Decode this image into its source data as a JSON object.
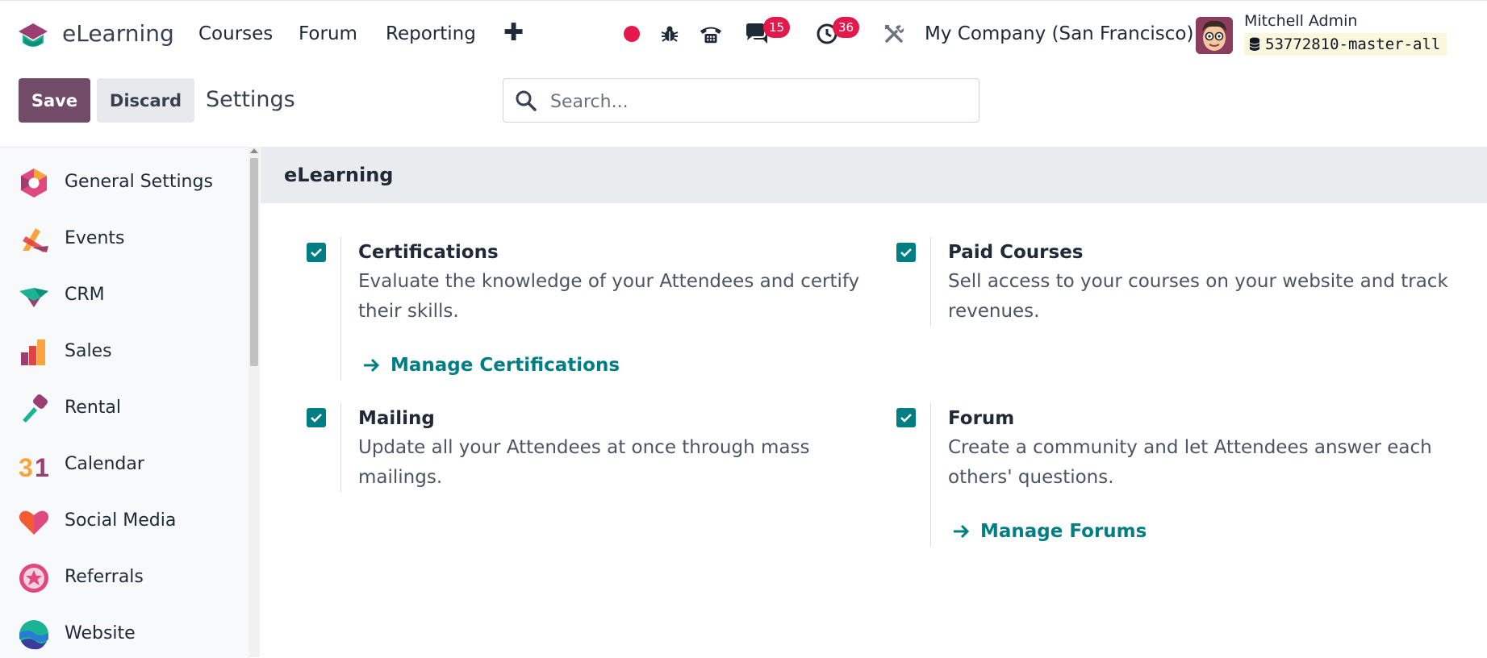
{
  "navbar": {
    "app_name": "eLearning",
    "menus": [
      "Courses",
      "Forum",
      "Reporting"
    ],
    "add_icon": "plus-icon",
    "systray": {
      "record_icon": "record-dot-icon",
      "debug_icon": "bug-icon",
      "phone_icon": "phone-icon",
      "messages_icon": "chat-icon",
      "messages_count": "15",
      "activities_icon": "clock-icon",
      "activities_count": "36",
      "tools_icon": "tools-icon"
    },
    "company": "My Company (San Francisco)",
    "user_name": "Mitchell Admin",
    "database": "53772810-master-all"
  },
  "control_panel": {
    "save_label": "Save",
    "discard_label": "Discard",
    "breadcrumb": "Settings",
    "search_placeholder": "Search..."
  },
  "sidebar": {
    "items": [
      {
        "label": "General Settings",
        "icon": "general-settings-icon"
      },
      {
        "label": "Events",
        "icon": "events-icon"
      },
      {
        "label": "CRM",
        "icon": "crm-icon"
      },
      {
        "label": "Sales",
        "icon": "sales-icon"
      },
      {
        "label": "Rental",
        "icon": "rental-icon"
      },
      {
        "label": "Calendar",
        "icon": "calendar-icon"
      },
      {
        "label": "Social Media",
        "icon": "social-media-icon"
      },
      {
        "label": "Referrals",
        "icon": "referrals-icon"
      },
      {
        "label": "Website",
        "icon": "website-icon"
      }
    ]
  },
  "main": {
    "section_title": "eLearning",
    "settings": [
      {
        "title": "Certifications",
        "desc": "Evaluate the knowledge of your Attendees and certify their skills.",
        "checked": true,
        "link": "Manage Certifications"
      },
      {
        "title": "Paid Courses",
        "desc": "Sell access to your courses on your website and track revenues.",
        "checked": true,
        "link": ""
      },
      {
        "title": "Mailing",
        "desc": "Update all your Attendees at once through mass mailings.",
        "checked": true,
        "link": ""
      },
      {
        "title": "Forum",
        "desc": "Create a community and let Attendees answer each others' questions.",
        "checked": true,
        "link": "Manage Forums"
      }
    ]
  },
  "colors": {
    "brand": "#714b67",
    "accent": "#017e84",
    "badge": "#e4184b"
  }
}
